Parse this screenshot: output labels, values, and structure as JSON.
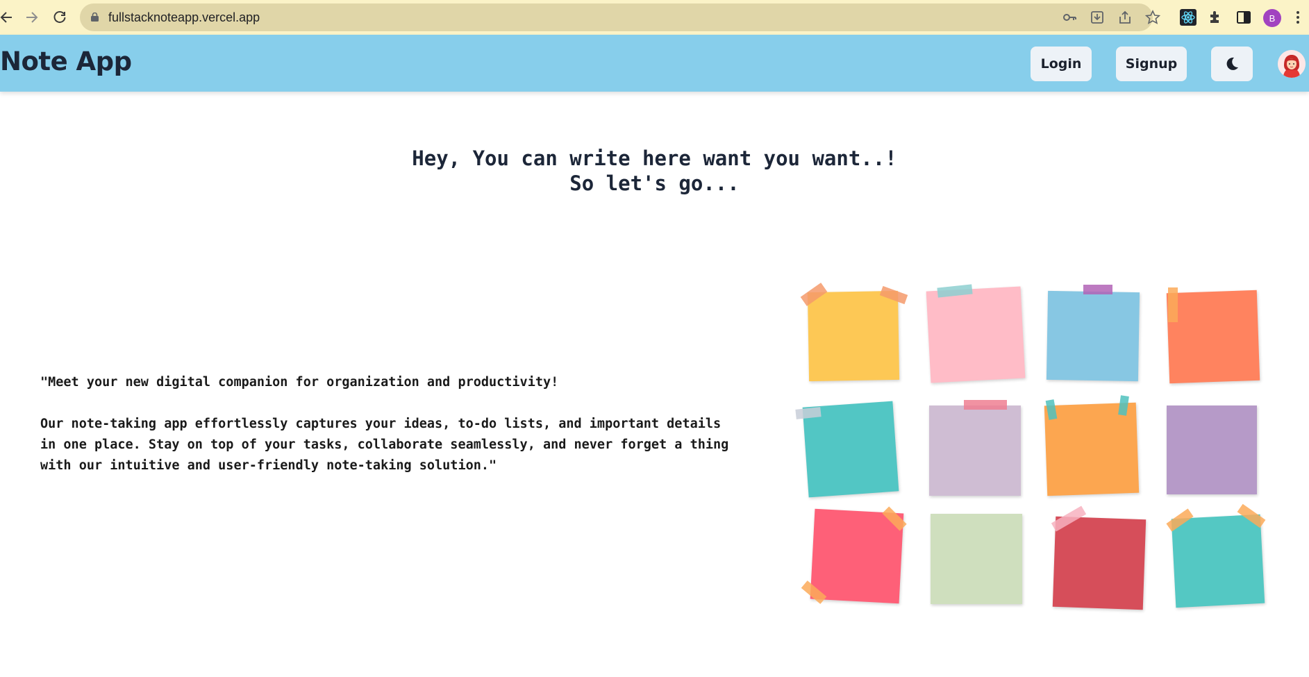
{
  "browser": {
    "url": "fullstacknoteapp.vercel.app",
    "profile_initial": "B"
  },
  "navbar": {
    "brand": "Note App",
    "login_label": "Login",
    "signup_label": "Signup",
    "theme_toggle_icon": "moon-icon",
    "avatar_icon": "user-avatar-icon",
    "bg_color": "#87ceeb"
  },
  "hero": {
    "line1": "Hey, You can write here want you want..!",
    "line2": "So let's go..."
  },
  "description": {
    "paragraph1": "\"Meet your new digital companion for organization and productivity!",
    "paragraph2": "Our note-taking app effortlessly captures your ideas, to-do lists, and important details in one place. Stay on top of your tasks, collaborate seamlessly, and never forget a thing with our intuitive and user-friendly note-taking solution.\""
  },
  "illustration": {
    "name": "sticky-notes-illustration",
    "note_colors": [
      "#fdc855",
      "#ffbcc7",
      "#87c7e3",
      "#ff835f",
      "#52c6c4",
      "#cfbdd3",
      "#fca650",
      "#b69ac8",
      "#fe6078",
      "#cfdfbe",
      "#d64e5a",
      "#54c8c3"
    ]
  }
}
